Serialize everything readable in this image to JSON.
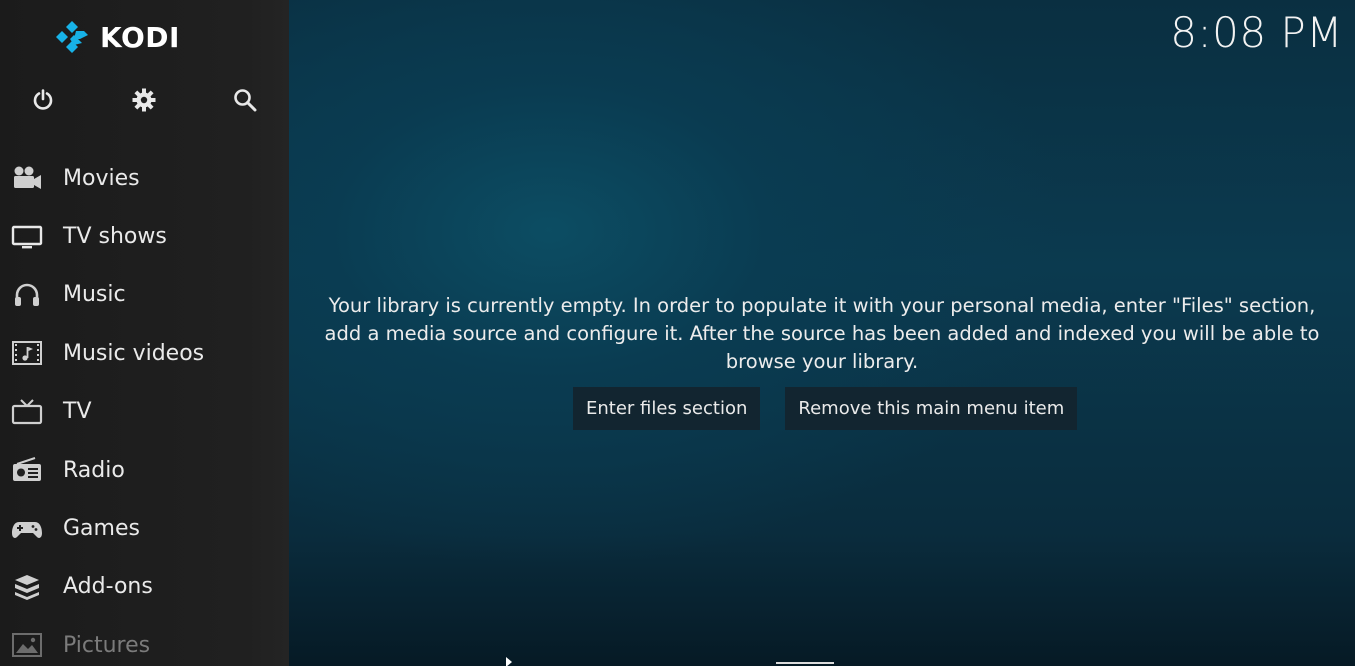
{
  "app": {
    "name": "KODI",
    "clock": "8:08 PM",
    "accent": "#17b2e7"
  },
  "top_icons": [
    {
      "name": "power-icon",
      "label": "Power"
    },
    {
      "name": "settings-icon",
      "label": "Settings"
    },
    {
      "name": "search-icon",
      "label": "Search"
    }
  ],
  "menu": {
    "items": [
      {
        "label": "Movies",
        "icon": "movie-camera-icon"
      },
      {
        "label": "TV shows",
        "icon": "monitor-icon"
      },
      {
        "label": "Music",
        "icon": "headphones-icon"
      },
      {
        "label": "Music videos",
        "icon": "film-music-icon"
      },
      {
        "label": "TV",
        "icon": "tv-icon"
      },
      {
        "label": "Radio",
        "icon": "radio-icon"
      },
      {
        "label": "Games",
        "icon": "gamepad-icon"
      },
      {
        "label": "Add-ons",
        "icon": "box-icon"
      },
      {
        "label": "Pictures",
        "icon": "picture-icon"
      }
    ]
  },
  "main": {
    "message": "Your library is currently empty. In order to populate it with your personal media, enter \"Files\" section, add a media source and configure it. After the source has been added and indexed you will be able to browse your library.",
    "enter_files_label": "Enter files section",
    "remove_item_label": "Remove this main menu item"
  }
}
